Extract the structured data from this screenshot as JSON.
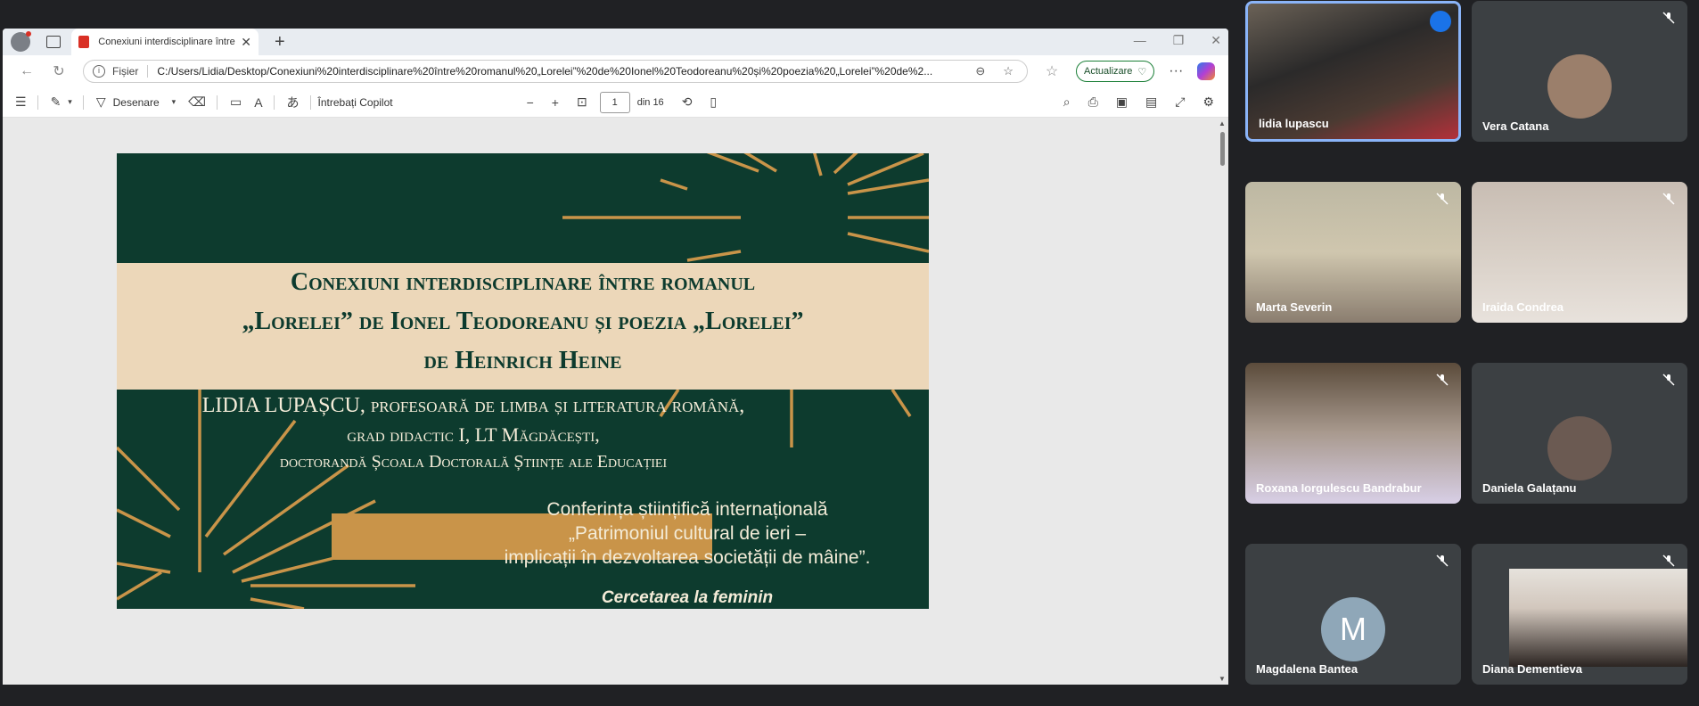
{
  "browser": {
    "tab_title": "Conexiuni interdisciplinare între r...",
    "scheme_label": "Fișier",
    "url": "C:/Users/Lidia/Desktop/Conexiuni%20interdisciplinare%20între%20romanul%20„Lorelei”%20de%20Ionel%20Teodoreanu%20și%20poezia%20„Lorelei”%20de%2...",
    "update_label": "Actualizare",
    "icons": [
      "profile-icon",
      "tabs-icon",
      "pdf-icon",
      "close-icon",
      "new-tab-icon",
      "back-icon",
      "refresh-icon",
      "info-icon",
      "zoom-icon",
      "star-icon",
      "favorites-icon",
      "more-icon",
      "copilot-icon"
    ]
  },
  "pdf_toolbar": {
    "draw_label": "Desenare",
    "copilot_label": "Întrebați Copilot",
    "page_current": "1",
    "page_total_label": "din 16"
  },
  "slide": {
    "title_lines": [
      "Conexiuni interdisciplinare între romanul",
      "„Lorelei” de Ionel Teodoreanu și poezia „Lorelei”",
      "de Heinrich Heine"
    ],
    "author_line1": "LIDIA LUPAȘCU, profesoară de limba și literatura română,",
    "author_line2": "grad didactic I, LT Măgdăcești,",
    "author_line3": "doctorandă Școala Doctorală Științe ale Educației",
    "conference_lines": [
      "Conferința științifică internațională",
      "„Patrimoniul cultural de ieri –",
      "implicații în dezvoltarea societății de mâine”."
    ],
    "footer": "Cercetarea la feminin",
    "colors": {
      "background": "#0d3b2e",
      "band": "#ecd7b9",
      "accent": "#c99449"
    }
  },
  "participants": [
    {
      "name": "lidia lupascu",
      "speaking": true
    },
    {
      "name": "Vera Catana",
      "muted": true
    },
    {
      "name": "Marta Severin",
      "muted": true
    },
    {
      "name": "Iraida Condrea",
      "muted": true
    },
    {
      "name": "Roxana Iorgulescu Bandrabur",
      "muted": true
    },
    {
      "name": "Daniela Galațanu",
      "muted": true
    },
    {
      "name": "Magdalena Bantea",
      "muted": true,
      "initial": "M"
    },
    {
      "name": "Diana Dementieva",
      "muted": true
    }
  ]
}
